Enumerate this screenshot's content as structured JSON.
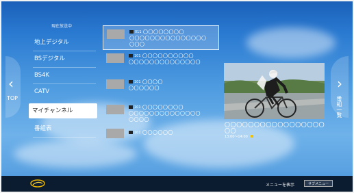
{
  "nav": {
    "left_label": "TOP",
    "right_label": "番組一覧"
  },
  "sidebar": {
    "header": "現在放送中",
    "items": [
      {
        "label": "地上デジタル"
      },
      {
        "label": "BSデジタル"
      },
      {
        "label": "BS4K"
      },
      {
        "label": "CATV"
      },
      {
        "label": "マイチャンネル"
      },
      {
        "label": "番組表"
      }
    ],
    "selected_index": 4
  },
  "channels": [
    {
      "ch": "011",
      "line1": "〇〇〇〇〇〇〇〇",
      "line2": "〇〇〇〇〇〇〇〇〇〇〇〇〇〇〇",
      "line3": "〇〇〇"
    },
    {
      "ch": "101",
      "line1": "〇〇〇〇〇〇〇〇〇〇",
      "line2": "〇〇〇〇〇〇〇〇〇〇〇〇〇〇",
      "line3": ""
    },
    {
      "ch": "101",
      "line1": "〇〇〇〇",
      "line2": "〇〇〇〇〇〇",
      "line3": ""
    },
    {
      "ch": "101",
      "line1": "〇〇〇〇〇〇〇〇",
      "line2": "〇〇〇〇〇〇〇〇〇〇〇〇〇〇",
      "line3": "〇〇〇〇"
    },
    {
      "ch": "101",
      "line1": "〇〇〇〇〇〇",
      "line2": "",
      "line3": ""
    }
  ],
  "preview": {
    "title": "〇〇〇〇〇〇〇〇〇〇〇〇〇〇〇〇〇〇〇",
    "time": "13:00〜14:00"
  },
  "footer": {
    "menu_hint": "メニューを表示",
    "submenu_label": "サブメニュー"
  },
  "colors": {
    "background_top": "#1a5fb8",
    "background_mid": "#6fb2ea",
    "bottom_bar": "#0c1c30",
    "selected_item_bg": "#ffffff",
    "time_icon": "#f3c300"
  }
}
